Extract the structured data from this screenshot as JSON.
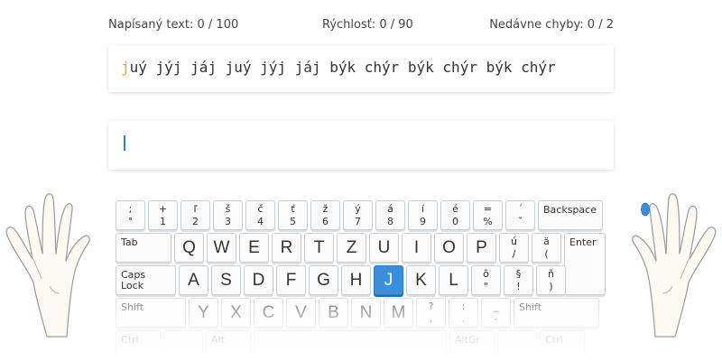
{
  "stats": {
    "typed": "Napísaný text: 0 / 100",
    "speed": "Rýchlosť: 0 / 90",
    "errors": "Nedávne chyby: 0 / 2"
  },
  "lesson": {
    "current_char": "j",
    "remaining_text": "uý jýj jáj juý jýj jáj býk chýr býk chýr býk chýr",
    "input_value": ""
  },
  "keyboard": {
    "rows": [
      [
        {
          "upper": ";",
          "lower": "°"
        },
        {
          "upper": "+",
          "lower": "1"
        },
        {
          "upper": "ľ",
          "lower": "2"
        },
        {
          "upper": "š",
          "lower": "3"
        },
        {
          "upper": "č",
          "lower": "4"
        },
        {
          "upper": "ť",
          "lower": "5"
        },
        {
          "upper": "ž",
          "lower": "6"
        },
        {
          "upper": "ý",
          "lower": "7"
        },
        {
          "upper": "á",
          "lower": "8"
        },
        {
          "upper": "í",
          "lower": "9"
        },
        {
          "upper": "é",
          "lower": "0"
        },
        {
          "upper": "=",
          "lower": "%"
        },
        {
          "upper": "´",
          "lower": "ˇ"
        },
        {
          "label": "Backspace"
        }
      ],
      [
        {
          "label": "Tab"
        },
        {
          "char": "Q"
        },
        {
          "char": "W"
        },
        {
          "char": "E"
        },
        {
          "char": "R"
        },
        {
          "char": "T"
        },
        {
          "char": "Z"
        },
        {
          "char": "U"
        },
        {
          "char": "I"
        },
        {
          "char": "O"
        },
        {
          "char": "P"
        },
        {
          "upper": "ú",
          "lower": "/"
        },
        {
          "upper": "ä",
          "lower": "("
        },
        {
          "label": "Enter"
        }
      ],
      [
        {
          "label": "Caps Lock"
        },
        {
          "char": "A"
        },
        {
          "char": "S"
        },
        {
          "char": "D"
        },
        {
          "char": "F"
        },
        {
          "char": "G"
        },
        {
          "char": "H"
        },
        {
          "char": "J",
          "active": true
        },
        {
          "char": "K"
        },
        {
          "char": "L"
        },
        {
          "upper": "ô",
          "lower": "\""
        },
        {
          "upper": "§",
          "lower": "!"
        },
        {
          "upper": "ň",
          "lower": ")"
        }
      ],
      [
        {
          "label": "Shift"
        },
        {
          "char": "Y"
        },
        {
          "char": "X"
        },
        {
          "char": "C"
        },
        {
          "char": "V"
        },
        {
          "char": "B"
        },
        {
          "char": "N"
        },
        {
          "char": "M"
        },
        {
          "upper": "?",
          "lower": ","
        },
        {
          "upper": ":",
          "lower": "."
        },
        {
          "upper": "_",
          "lower": "-"
        },
        {
          "label": "Shift"
        }
      ],
      [
        {
          "label": "Ctrl"
        },
        {
          "label": ""
        },
        {
          "label": "Alt"
        },
        {
          "label": ""
        },
        {
          "label": "AltGr"
        },
        {
          "label": ""
        },
        {
          "label": "Ctrl"
        }
      ]
    ]
  },
  "colors": {
    "active_key": "#3a8fdc",
    "current_char": "#e8a21e",
    "caret": "#2d7fd3",
    "highlighted_finger": "#3a8fdc"
  },
  "hands": {
    "highlighted_finger": "right-index-finger"
  }
}
